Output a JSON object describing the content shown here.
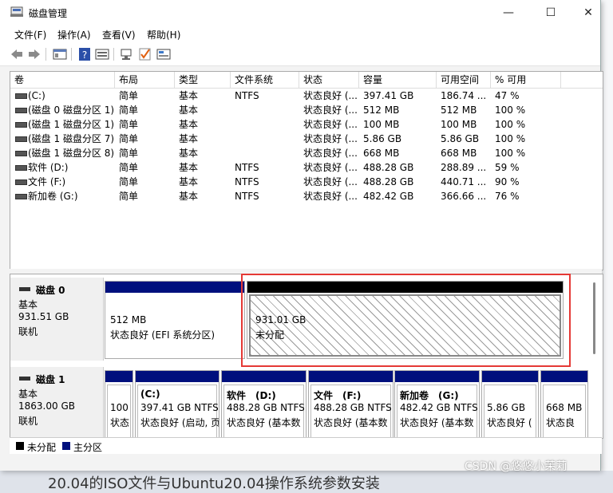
{
  "window": {
    "title": "磁盘管理",
    "buttons": {
      "minimize": "—",
      "maximize": "☐",
      "close": "✕"
    }
  },
  "menu": [
    "文件(F)",
    "操作(A)",
    "查看(V)",
    "帮助(H)"
  ],
  "columns": [
    "卷",
    "布局",
    "类型",
    "文件系统",
    "状态",
    "容量",
    "可用空间",
    "% 可用"
  ],
  "volumes": [
    {
      "name": "(C:)",
      "layout": "简单",
      "type": "基本",
      "fs": "NTFS",
      "status": "状态良好 (...",
      "capacity": "397.41 GB",
      "free": "186.74 ...",
      "pct": "47 %"
    },
    {
      "name": "(磁盘 0 磁盘分区 1)",
      "layout": "简单",
      "type": "基本",
      "fs": "",
      "status": "状态良好 (...",
      "capacity": "512 MB",
      "free": "512 MB",
      "pct": "100 %"
    },
    {
      "name": "(磁盘 1 磁盘分区 1)",
      "layout": "简单",
      "type": "基本",
      "fs": "",
      "status": "状态良好 (...",
      "capacity": "100 MB",
      "free": "100 MB",
      "pct": "100 %"
    },
    {
      "name": "(磁盘 1 磁盘分区 7)",
      "layout": "简单",
      "type": "基本",
      "fs": "",
      "status": "状态良好 (...",
      "capacity": "5.86 GB",
      "free": "5.86 GB",
      "pct": "100 %"
    },
    {
      "name": "(磁盘 1 磁盘分区 8)",
      "layout": "简单",
      "type": "基本",
      "fs": "",
      "status": "状态良好 (...",
      "capacity": "668 MB",
      "free": "668 MB",
      "pct": "100 %"
    },
    {
      "name": "软件 (D:)",
      "layout": "简单",
      "type": "基本",
      "fs": "NTFS",
      "status": "状态良好 (...",
      "capacity": "488.28 GB",
      "free": "288.89 ...",
      "pct": "59 %"
    },
    {
      "name": "文件 (F:)",
      "layout": "简单",
      "type": "基本",
      "fs": "NTFS",
      "status": "状态良好 (...",
      "capacity": "488.28 GB",
      "free": "440.71 ...",
      "pct": "90 %"
    },
    {
      "name": "新加卷 (G:)",
      "layout": "简单",
      "type": "基本",
      "fs": "NTFS",
      "status": "状态良好 (...",
      "capacity": "482.42 GB",
      "free": "366.66 ...",
      "pct": "76 %"
    }
  ],
  "disks": [
    {
      "title": "磁盘 0",
      "kind": "基本",
      "size": "931.51 GB",
      "state": "联机",
      "partitions": [
        {
          "name": "",
          "line1": "512 MB",
          "line2": "状态良好 (EFI 系统分区)",
          "bar": "primary"
        },
        {
          "name": "",
          "line1": "931.01 GB",
          "line2": "未分配",
          "bar": "unallocated"
        }
      ]
    },
    {
      "title": "磁盘 1",
      "kind": "基本",
      "size": "1863.00 GB",
      "state": "联机",
      "partitions": [
        {
          "name": "",
          "line1": "100",
          "line2": "状态",
          "bar": "primary"
        },
        {
          "name": "(C:)",
          "line1": "397.41 GB NTFS",
          "line2": "状态良好 (启动, 页",
          "bar": "primary"
        },
        {
          "name": "软件　(D:)",
          "line1": "488.28 GB NTFS",
          "line2": "状态良好 (基本数",
          "bar": "primary"
        },
        {
          "name": "文件　(F:)",
          "line1": "488.28 GB NTFS",
          "line2": "状态良好 (基本数",
          "bar": "primary"
        },
        {
          "name": "新加卷　(G:)",
          "line1": "482.42 GB NTFS",
          "line2": "状态良好 (基本数",
          "bar": "primary"
        },
        {
          "name": "",
          "line1": "5.86 GB",
          "line2": "状态良好 (",
          "bar": "primary"
        },
        {
          "name": "",
          "line1": "668 MB",
          "line2": "状态良",
          "bar": "primary"
        }
      ]
    }
  ],
  "legend": {
    "unallocated": "未分配",
    "primary": "主分区"
  },
  "colors": {
    "primary": "#00107d",
    "unallocated": "#000000",
    "highlight": "#e53935"
  },
  "watermark": "CSDN @悠悠小茉莉",
  "background": {
    "bottom_text": "20.04的ISO文件与Ubuntu20.04操作系统参数安装"
  }
}
